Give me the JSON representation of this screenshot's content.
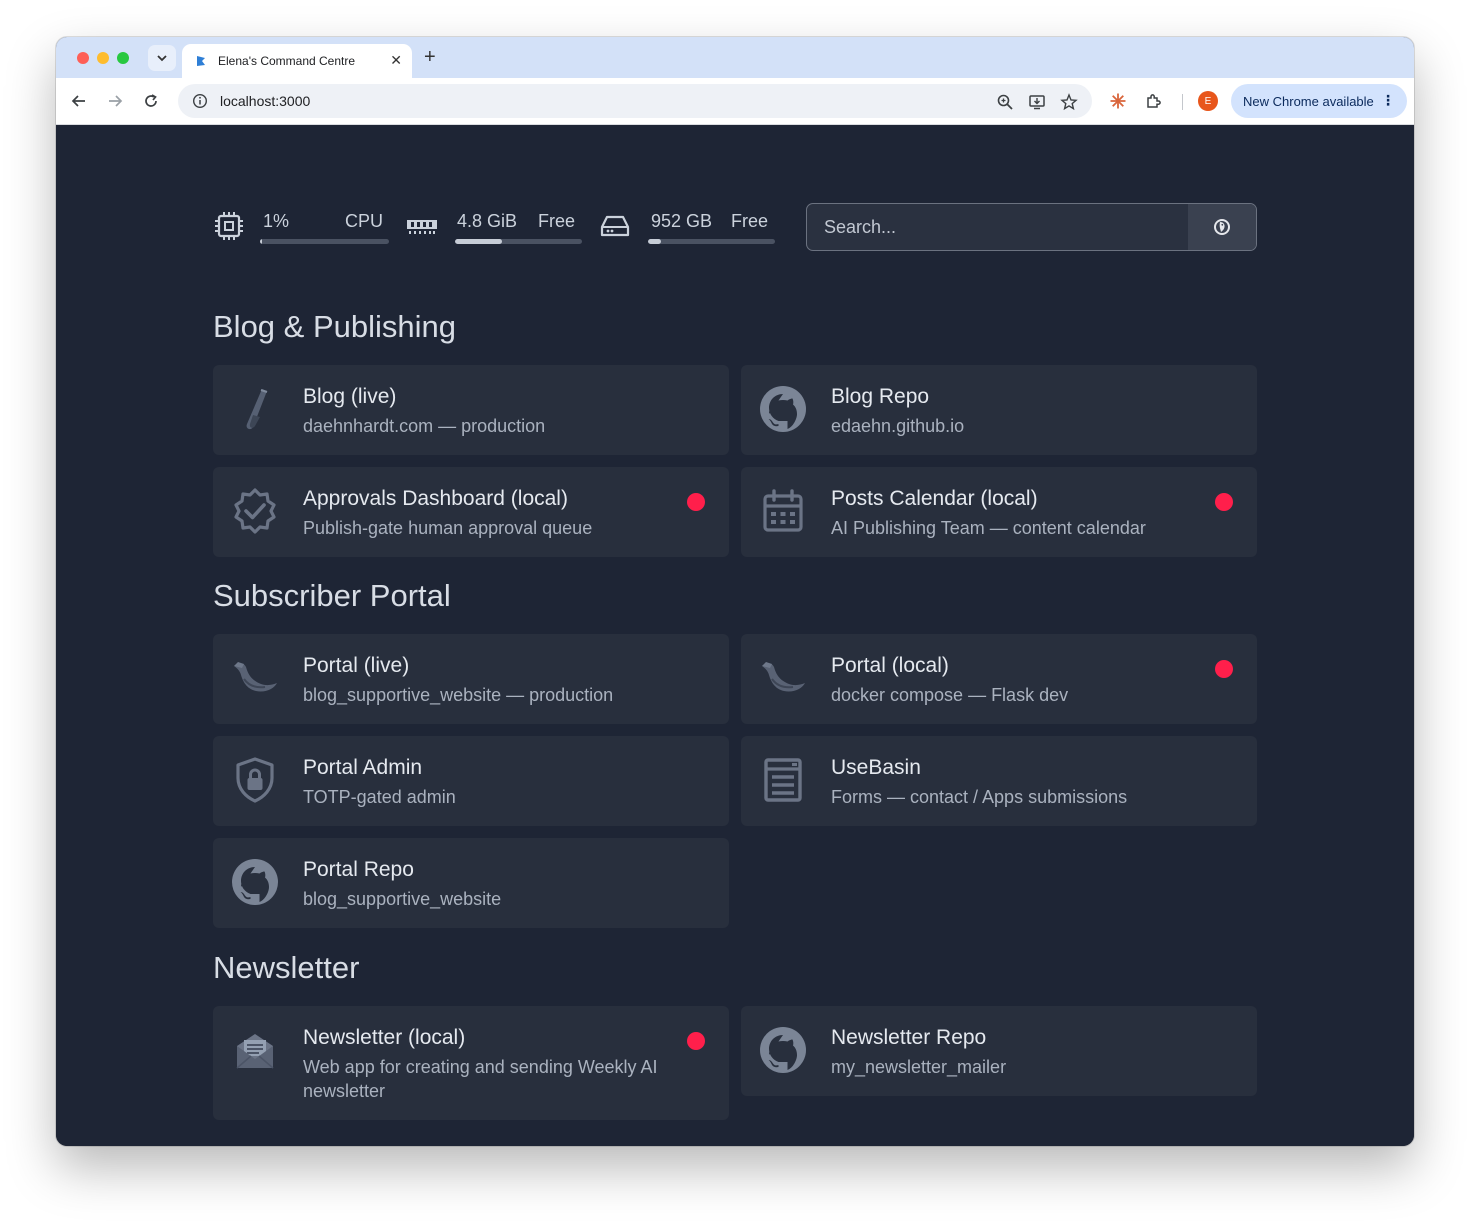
{
  "browser": {
    "tab_title": "Elena's Command Centre",
    "url": "localhost:3000",
    "avatar_letter": "E",
    "update_label": "New Chrome available"
  },
  "stats": {
    "cpu": {
      "value": "1%",
      "label": "CPU",
      "fraction": 0.01
    },
    "memory": {
      "value": "4.8 GiB",
      "label": "Free",
      "fraction": 0.37
    },
    "disk": {
      "value": "952 GB",
      "label": "Free",
      "fraction": 0.1
    }
  },
  "search": {
    "placeholder": "Search..."
  },
  "sections": [
    {
      "title": "Blog & Publishing",
      "items": [
        {
          "title": "Blog (live)",
          "subtitle": "daehnhardt.com — production",
          "icon": "test-tube-icon",
          "status": false
        },
        {
          "title": "Blog Repo",
          "subtitle": "edaehn.github.io",
          "icon": "github-icon",
          "status": false
        },
        {
          "title": "Approvals Dashboard (local)",
          "subtitle": "Publish-gate human approval queue",
          "icon": "verified-badge-icon",
          "status": true
        },
        {
          "title": "Posts Calendar (local)",
          "subtitle": "AI Publishing Team — content calendar",
          "icon": "calendar-icon",
          "status": true
        }
      ]
    },
    {
      "title": "Subscriber Portal",
      "items": [
        {
          "title": "Portal (live)",
          "subtitle": "blog_supportive_website — production",
          "icon": "flask-horn-icon",
          "status": false
        },
        {
          "title": "Portal (local)",
          "subtitle": "docker compose — Flask dev",
          "icon": "flask-horn-icon",
          "status": true
        },
        {
          "title": "Portal Admin",
          "subtitle": "TOTP-gated admin",
          "icon": "shield-lock-icon",
          "status": false
        },
        {
          "title": "UseBasin",
          "subtitle": "Forms — contact / Apps submissions",
          "icon": "form-icon",
          "status": false
        },
        {
          "title": "Portal Repo",
          "subtitle": "blog_supportive_website",
          "icon": "github-icon",
          "status": false
        }
      ]
    },
    {
      "title": "Newsletter",
      "items": [
        {
          "title": "Newsletter (local)",
          "subtitle": "Web app for creating and sending Weekly AI newsletter",
          "icon": "mail-open-icon",
          "status": true
        },
        {
          "title": "Newsletter Repo",
          "subtitle": "my_newsletter_mailer",
          "icon": "github-icon",
          "status": false
        }
      ]
    }
  ],
  "colors": {
    "page_bg": "#1e2535",
    "card_bg": "#282f3d",
    "status_dot": "#ff1f4b"
  }
}
